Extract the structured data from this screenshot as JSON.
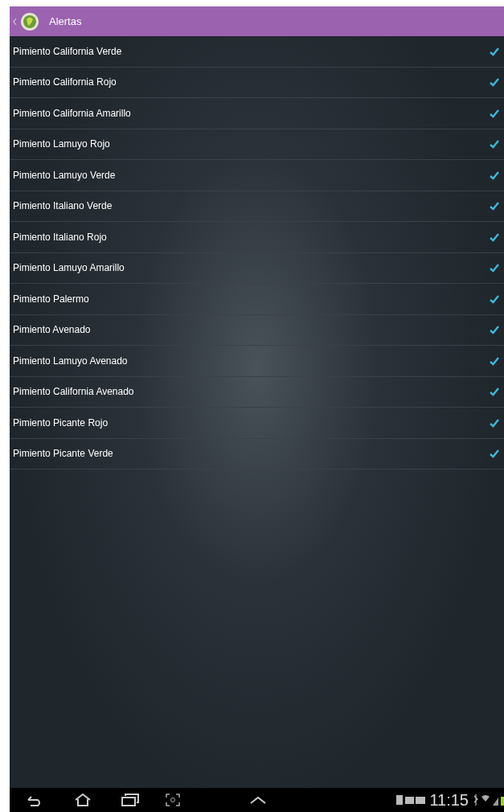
{
  "action_bar": {
    "title": "Alertas"
  },
  "items": [
    {
      "label": "Pimiento California Verde",
      "checked": true
    },
    {
      "label": "Pimiento California Rojo",
      "checked": true
    },
    {
      "label": "Pimiento California Amarillo",
      "checked": true
    },
    {
      "label": "Pimiento Lamuyo Rojo",
      "checked": true
    },
    {
      "label": "Pimiento Lamuyo Verde",
      "checked": true
    },
    {
      "label": "Pimiento Italiano Verde",
      "checked": true
    },
    {
      "label": "Pimiento Italiano Rojo",
      "checked": true
    },
    {
      "label": "Pimiento Lamuyo Amarillo",
      "checked": true
    },
    {
      "label": "Pimiento Palermo",
      "checked": true
    },
    {
      "label": "Pimiento Avenado",
      "checked": true
    },
    {
      "label": "Pimiento Lamuyo Avenado",
      "checked": true
    },
    {
      "label": "Pimiento California Avenado",
      "checked": true
    },
    {
      "label": "Pimiento Picante Rojo",
      "checked": true
    },
    {
      "label": "Pimiento Picante Verde",
      "checked": true
    }
  ],
  "status_bar": {
    "time": "11:15"
  }
}
